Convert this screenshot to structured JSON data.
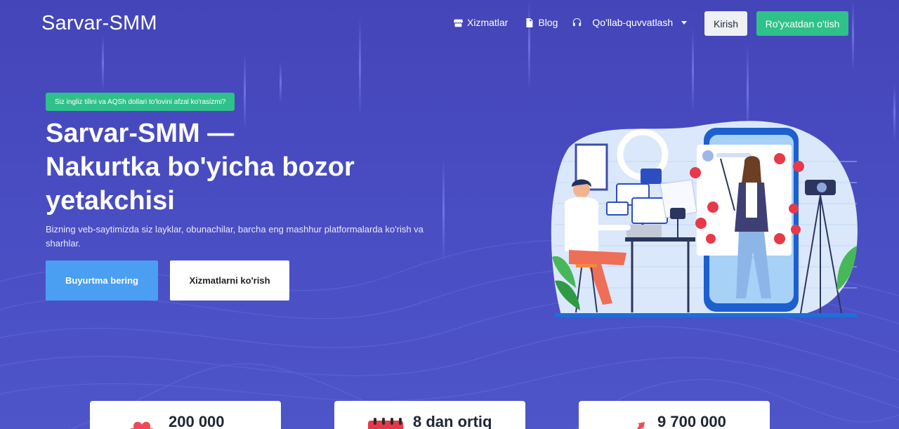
{
  "nav": {
    "brand": "Sarvar-SMM",
    "links": {
      "services": "Xizmatlar",
      "blog": "Blog",
      "support": "Qo'llab-quvvatlash"
    },
    "login": "Kirish",
    "register": "Ro'yxatdan o'tish"
  },
  "hero": {
    "badge": "Siz ingliz tilini va AQSh dollari to'lovini afzal ko'rasizmi?",
    "title_line1": "Sarvar-SMM —",
    "title_line2": "Nakurtka bo'yicha bozor",
    "title_line3": "yetakchisi",
    "subtitle": "Bizning veb-saytimizda siz layklar, obunachilar, barcha eng mashhur platformalarda ko'rish va sharhlar.",
    "order_button": "Buyurtma bering",
    "services_button": "Xizmatlarni ko'rish"
  },
  "stats": [
    {
      "value": "200 000",
      "icon": "hearts-icon"
    },
    {
      "value": "8 dan ortiq",
      "icon": "ticket-icon"
    },
    {
      "value": "9 700 000",
      "icon": "growth-arrow-icon"
    }
  ],
  "colors": {
    "background": "#4445b8",
    "accent_green": "#2fc18a",
    "accent_blue": "#4b9ff2"
  }
}
